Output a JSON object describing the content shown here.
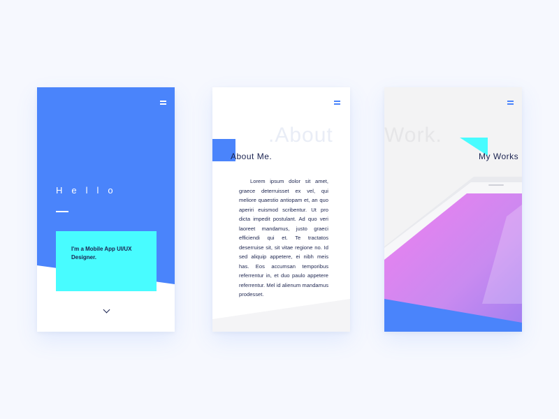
{
  "card1": {
    "greeting": "Hello",
    "intro": "I'm a Mobile App UI/UX Designer.",
    "icons": [
      "menu-icon",
      "chevron-down-icon"
    ]
  },
  "card2": {
    "watermark": ".About",
    "title": "About Me.",
    "body": "Lorem ipsum dolor sit amet, graece deterruisset ex vel, qui meliore quaestio antiopam et, an quo aperiri euismod scribentur. Ut pro dicta impedit postulant. Ad quo veri laoreet mandamus, justo graeci efficiendi qui et. Te tractatos deserruise sit, sit vitae regione no. Id sed aliquip appetere, ei nibh meis has. Eos accumsan temporibus referrentur in, et duo paulo appetere referrentur. Mel id alienum mandamus prodesset."
  },
  "card3": {
    "watermark": "Work.",
    "title": "My Works"
  },
  "colors": {
    "blue": "#4a84fb",
    "cyan": "#48fcff",
    "navy": "#1a2250",
    "background": "#f6f8fe"
  }
}
